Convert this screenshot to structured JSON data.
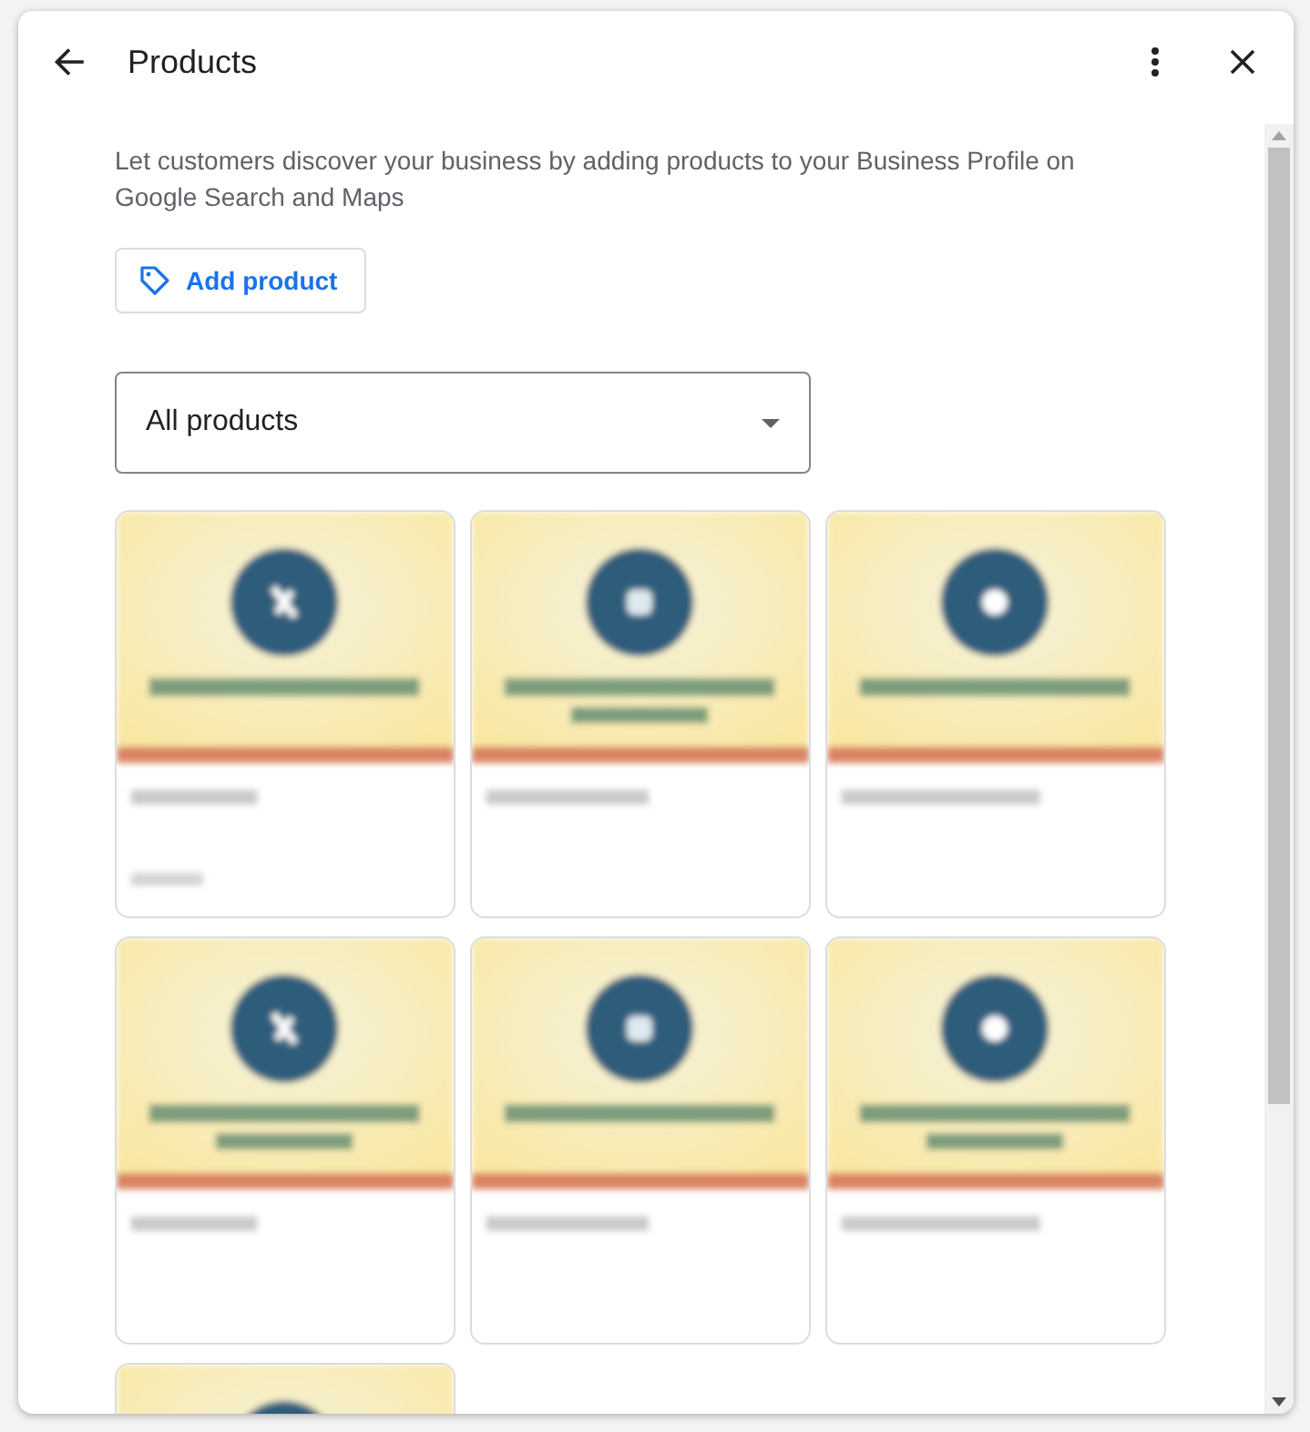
{
  "dialog": {
    "title": "Products"
  },
  "intro": "Let customers discover your business by adding products to your Business Profile on Google Search and Maps",
  "add_button": {
    "label": "Add product"
  },
  "filter": {
    "value": "All products"
  }
}
